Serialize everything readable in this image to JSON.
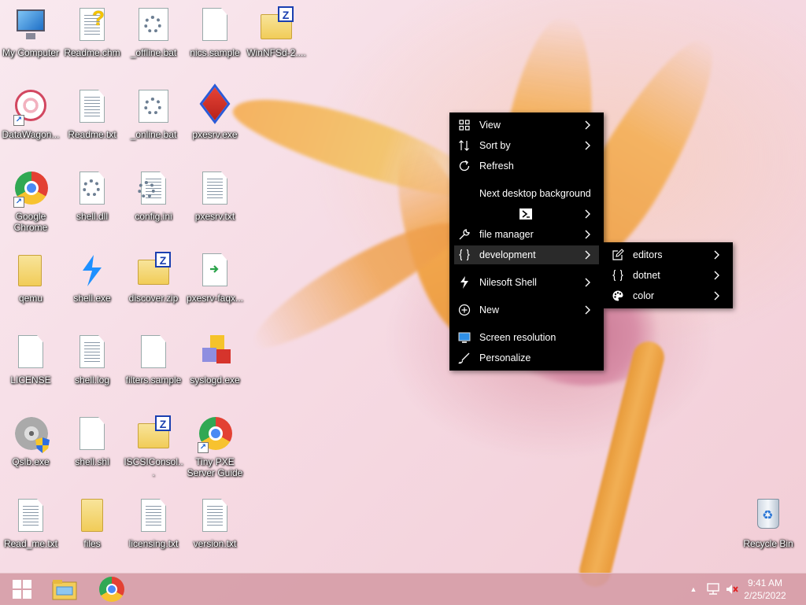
{
  "desktop": {
    "icons": [
      {
        "label": "My Computer"
      },
      {
        "label": "Readme.chm"
      },
      {
        "label": "_offline.bat"
      },
      {
        "label": "nics.sample"
      },
      {
        "label": "WinNFSd-2...."
      },
      {
        "label": "DataWagon..."
      },
      {
        "label": "Readme.txt"
      },
      {
        "label": "_online.bat"
      },
      {
        "label": "pxesrv.exe"
      },
      {
        "label": "Google Chrome"
      },
      {
        "label": "shell.dll"
      },
      {
        "label": "config.ini"
      },
      {
        "label": "pxesrv.txt"
      },
      {
        "label": "qemu"
      },
      {
        "label": "shell.exe"
      },
      {
        "label": "discover.zip"
      },
      {
        "label": "pxesrv-faqx..."
      },
      {
        "label": "LICENSE"
      },
      {
        "label": "shell.log"
      },
      {
        "label": "filters.sample"
      },
      {
        "label": "syslogd.exe"
      },
      {
        "label": "Qslb.exe"
      },
      {
        "label": "shell.shl"
      },
      {
        "label": "ISCSIConsol..."
      },
      {
        "label": "Tiny PXE Server Guide"
      },
      {
        "label": "Read_me.txt"
      },
      {
        "label": "files"
      },
      {
        "label": "licensing.txt"
      },
      {
        "label": "version.txt"
      },
      {
        "label": "Recycle Bin"
      }
    ]
  },
  "context_menu": {
    "items": [
      {
        "label": "View",
        "icon": "grid-icon",
        "has_submenu": true
      },
      {
        "label": "Sort by",
        "icon": "sort-icon",
        "has_submenu": true
      },
      {
        "label": "Refresh",
        "icon": "refresh-icon",
        "has_submenu": false
      },
      {
        "label": "Next desktop background",
        "icon": "",
        "has_submenu": false
      },
      {
        "label": "",
        "icon": "terminal-icon",
        "has_submenu": true
      },
      {
        "label": "file manager",
        "icon": "wrench-icon",
        "has_submenu": true
      },
      {
        "label": "development",
        "icon": "braces-icon",
        "has_submenu": true,
        "highlighted": true
      },
      {
        "label": "Nilesoft Shell",
        "icon": "nilesoft-icon",
        "has_submenu": true
      },
      {
        "label": "New",
        "icon": "plus-circle-icon",
        "has_submenu": true
      },
      {
        "label": "Screen resolution",
        "icon": "monitor-icon",
        "has_submenu": false
      },
      {
        "label": "Personalize",
        "icon": "brush-icon",
        "has_submenu": false
      }
    ]
  },
  "submenu": {
    "items": [
      {
        "label": "editors",
        "icon": "edit-icon"
      },
      {
        "label": "dotnet",
        "icon": "braces-icon"
      },
      {
        "label": "color",
        "icon": "palette-icon"
      }
    ]
  },
  "taskbar": {
    "clock_time": "9:41 AM",
    "clock_date": "2/25/2022",
    "tray_chevron": "▲"
  },
  "colors": {
    "menu_bg": "#000000",
    "menu_hover": "#2a2a2a",
    "taskbar": "#d59ba5"
  }
}
